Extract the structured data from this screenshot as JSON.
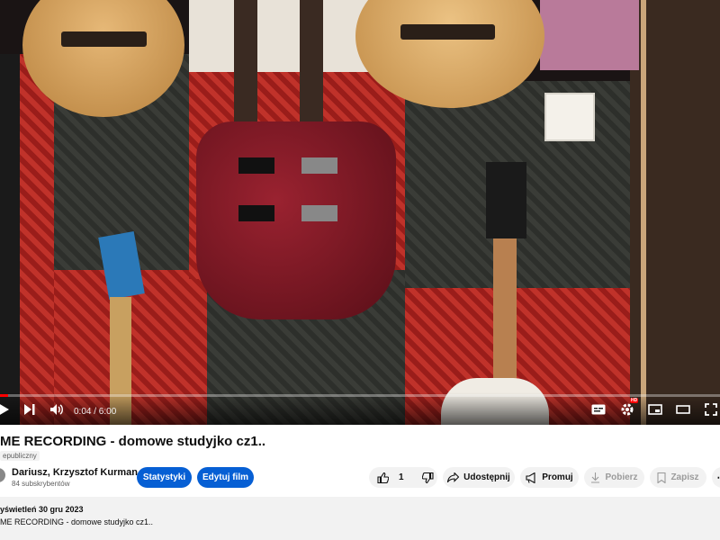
{
  "player": {
    "time_display": "0:04 / 6:00",
    "progress_fraction": 0.011,
    "settings_badge": "HD"
  },
  "video_info": {
    "title": "ME RECORDING - domowe studyjko cz1..",
    "visibility": "epubliczny"
  },
  "channel": {
    "name": "Dariusz, Krzysztof Kurman",
    "subscribers": "84 subskrybentów"
  },
  "actions": {
    "stats_label": "Statystyki",
    "edit_label": "Edytuj film",
    "like_count": "1",
    "share_label": "Udostępnij",
    "promote_label": "Promuj",
    "download_label": "Pobierz",
    "save_label": "Zapisz"
  },
  "description": {
    "views_date": "yświetleń  30 gru 2023",
    "text": "ME RECORDING - domowe studyjko cz1.."
  },
  "colors": {
    "accent_blue": "#065fd4",
    "progress_red": "#ff0000"
  },
  "icons": [
    "play-icon",
    "next-icon",
    "volume-icon",
    "subtitles-icon",
    "settings-icon",
    "miniplayer-icon",
    "theater-icon",
    "fullscreen-icon",
    "like-icon",
    "dislike-icon",
    "share-icon",
    "promote-icon",
    "download-icon",
    "save-icon",
    "more-icon"
  ]
}
